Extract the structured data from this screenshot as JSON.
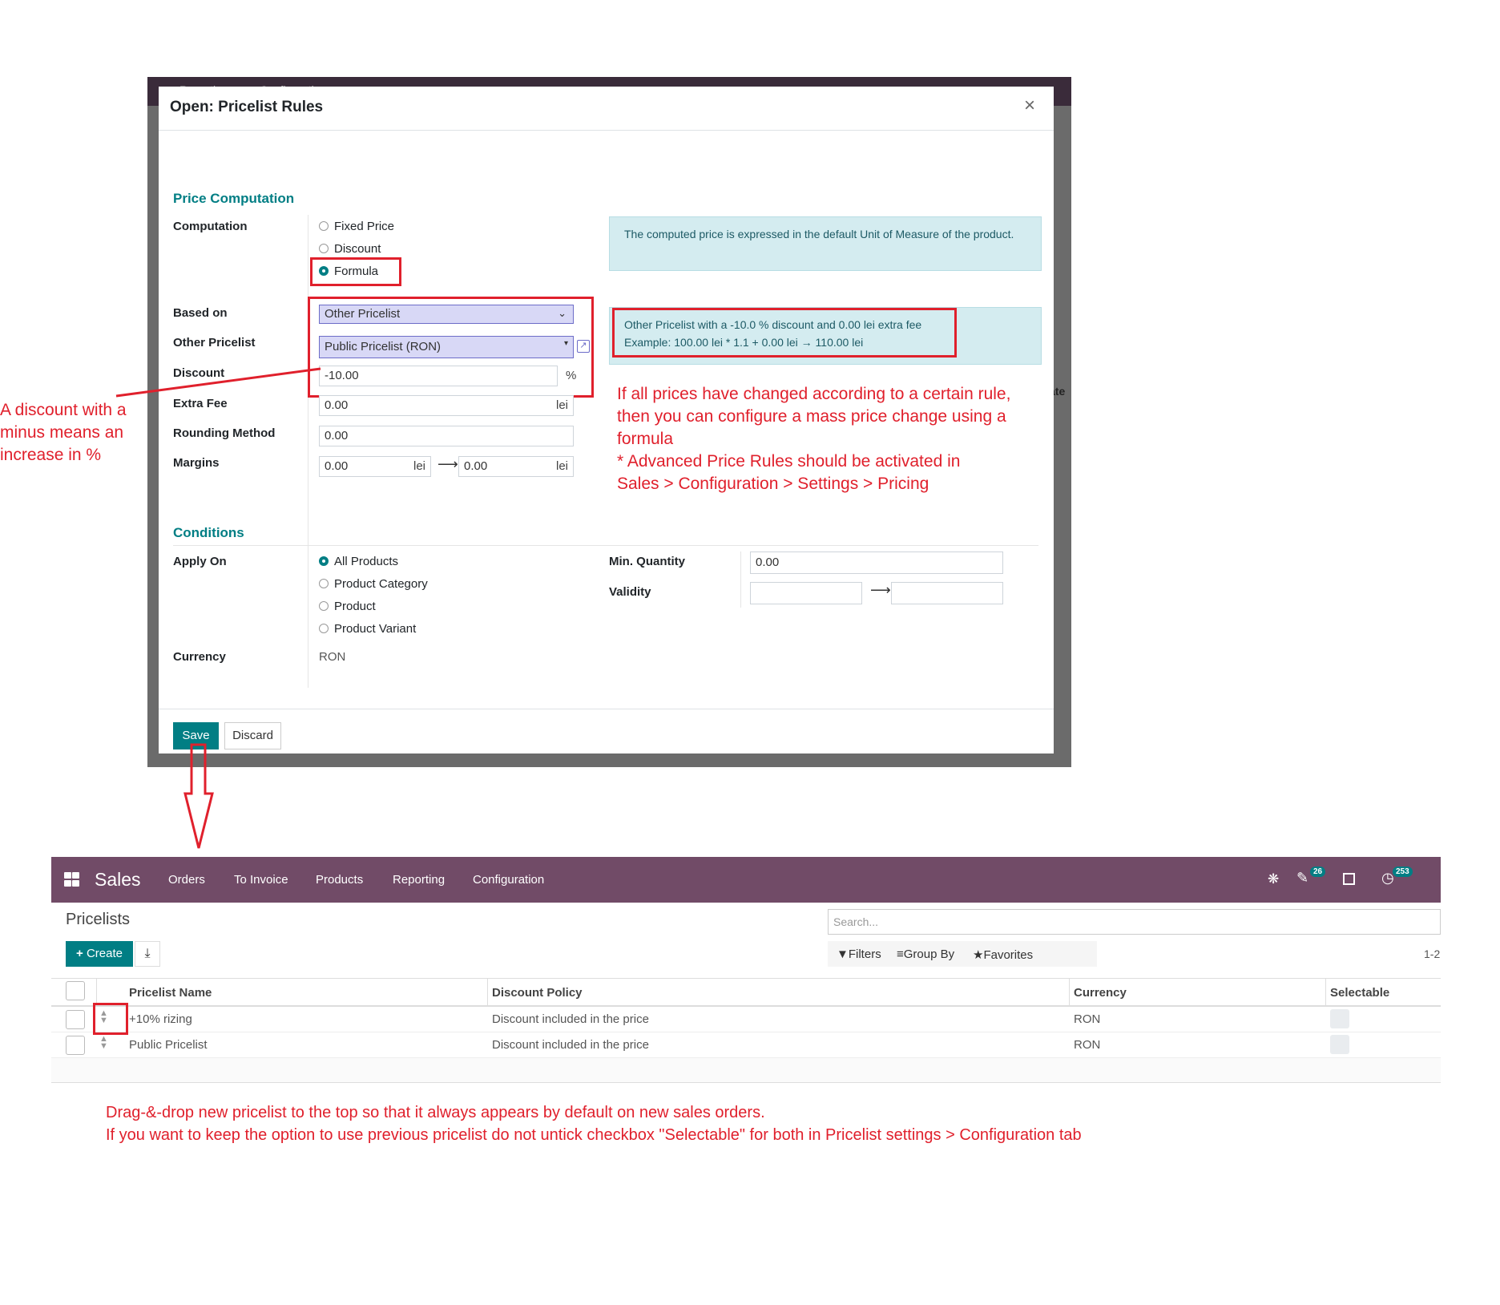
{
  "modal": {
    "title": "Open: Pricelist Rules",
    "close": "×",
    "background_bar_items": [
      "Reporting",
      "Configuration"
    ],
    "price_computation": {
      "section_title": "Price Computation",
      "computation_label": "Computation",
      "computation_options": [
        "Fixed Price",
        "Discount",
        "Formula"
      ],
      "computation_selected": "Formula",
      "uom_info": "The computed price is expressed in the default Unit of Measure of the product.",
      "based_on_label": "Based on",
      "based_on_value": "Other Pricelist",
      "other_pricelist_label": "Other Pricelist",
      "other_pricelist_value": "Public Pricelist (RON)",
      "discount_label": "Discount",
      "discount_value": "-10.00",
      "discount_unit": "%",
      "extra_fee_label": "Extra Fee",
      "extra_fee_value": "0.00",
      "extra_fee_unit": "lei",
      "rounding_label": "Rounding Method",
      "rounding_value": "0.00",
      "margins_label": "Margins",
      "margin_min": "0.00",
      "margin_max": "0.00",
      "margin_unit": "lei",
      "formula_info_line1": "Other Pricelist with a -10.0 % discount and 0.00 lei extra fee",
      "formula_info_line2": "Example: 100.00 lei * 1.1 + 0.00 lei → 110.00 lei"
    },
    "conditions": {
      "section_title": "Conditions",
      "apply_on_label": "Apply On",
      "apply_on_options": [
        "All Products",
        "Product Category",
        "Product",
        "Product Variant"
      ],
      "apply_on_selected": "All Products",
      "min_qty_label": "Min. Quantity",
      "min_qty_value": "0.00",
      "validity_label": "Validity",
      "currency_label": "Currency",
      "currency_value": "RON"
    },
    "footer": {
      "save": "Save",
      "discard": "Discard"
    },
    "partial_label_right": "ate"
  },
  "annotations": {
    "discount_note": [
      "A discount with a",
      "minus means an",
      "increase in %"
    ],
    "formula_note": [
      "If all prices have changed according to a certain rule,",
      "then you can configure a mass price change using a",
      "formula",
      "* Advanced Price Rules should be activated in",
      "Sales > Configuration > Settings > Pricing"
    ],
    "bottom_note": [
      "Drag-&-drop new pricelist to the top so that it always appears by default on new sales orders.",
      "If you want to keep the option to use previous pricelist do not untick checkbox \"Selectable\" for both in Pricelist settings > Configuration tab"
    ]
  },
  "sales": {
    "app_name": "Sales",
    "menu": [
      "Orders",
      "To Invoice",
      "Products",
      "Reporting",
      "Configuration"
    ],
    "chat_badge": "26",
    "activity_badge": "253",
    "breadcrumb": "Pricelists",
    "create_label": "Create",
    "search_placeholder": "Search...",
    "filters_label": "Filters",
    "groupby_label": "Group By",
    "favorites_label": "Favorites",
    "pager": "1-2",
    "columns": [
      "Pricelist Name",
      "Discount Policy",
      "Currency",
      "Selectable"
    ],
    "rows": [
      {
        "name": "+10% rizing",
        "policy": "Discount included in the price",
        "currency": "RON"
      },
      {
        "name": "Public Pricelist",
        "policy": "Discount included in the price",
        "currency": "RON"
      }
    ]
  },
  "colors": {
    "odoo_purple": "#714b67",
    "odoo_teal": "#017e84",
    "annotation_red": "#e0202c",
    "info_blue": "#d4ecf0"
  }
}
